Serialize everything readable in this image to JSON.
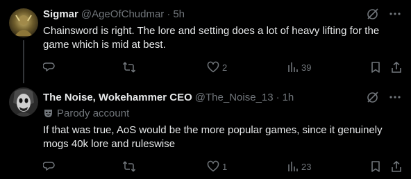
{
  "posts": [
    {
      "name": "Sigmar",
      "handle": "@AgeOfChudmar",
      "separator": "·",
      "time": "5h",
      "text": "Chainsword is right. The lore and setting does a lot of heavy lifting for the game which is mid at best.",
      "likes": "2",
      "views": "39"
    },
    {
      "name": "The Noise, Wokehammer CEO",
      "handle": "@The_Noise_13",
      "separator": "·",
      "time": "1h",
      "label": "Parody account",
      "text": "If that was true, AoS would be the more popular games, since it genuinely mogs 40k lore and ruleswise",
      "likes": "1",
      "views": "23"
    }
  ],
  "icons": {
    "more": "more-icon",
    "grok": "grok-icon",
    "reply": "reply-icon",
    "repost": "repost-icon",
    "like": "heart-icon",
    "views": "views-icon",
    "bookmark": "bookmark-icon",
    "share": "share-icon",
    "parody": "parody-mask-icon"
  },
  "colors": {
    "background": "#000000",
    "text": "#e7e9ea",
    "secondary": "#71767b"
  }
}
